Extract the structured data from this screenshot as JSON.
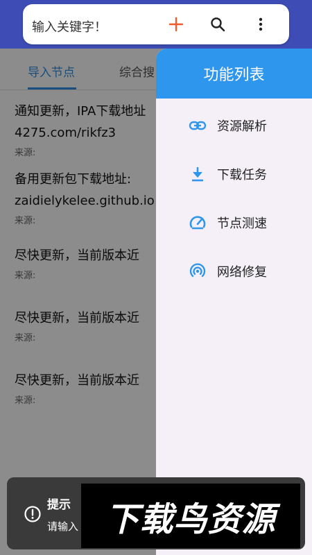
{
  "search": {
    "placeholder": "输入关键字！",
    "add_icon": "plus-icon",
    "search_icon": "search-icon",
    "more_icon": "more-vertical-icon"
  },
  "tabs": [
    {
      "label": "导入节点",
      "active": true
    },
    {
      "label": "综合搜"
    }
  ],
  "items": [
    {
      "title_line1": "通知更新，IPA下载地址",
      "title_line2": "4275.com/rikfz3",
      "source": "来源:"
    },
    {
      "title_line1": "备用更新包下载地址:",
      "title_line2": "zaidielykelee.github.io",
      "source": "来源:"
    },
    {
      "title_line1": "尽快更新，当前版本近",
      "source": "来源:"
    },
    {
      "title_line1": "尽快更新，当前版本近",
      "source": "来源:"
    },
    {
      "title_line1": "尽快更新，当前版本近",
      "source": "来源:"
    }
  ],
  "drawer": {
    "title": "功能列表",
    "menu": [
      {
        "label": "资源解析",
        "icon": "link-icon"
      },
      {
        "label": "下载任务",
        "icon": "download-icon"
      },
      {
        "label": "节点测速",
        "icon": "speedometer-icon"
      },
      {
        "label": "网络修复",
        "icon": "broadcast-icon"
      }
    ]
  },
  "toast": {
    "title": "提示",
    "message": "请输入",
    "icon": "info-circle-icon"
  },
  "watermark": {
    "text": "下载鸟资源"
  },
  "colors": {
    "header": "#3e4db5",
    "accent": "#2f96ee",
    "plus": "#f15a2b",
    "drawer_bg": "#f5f0f7"
  }
}
